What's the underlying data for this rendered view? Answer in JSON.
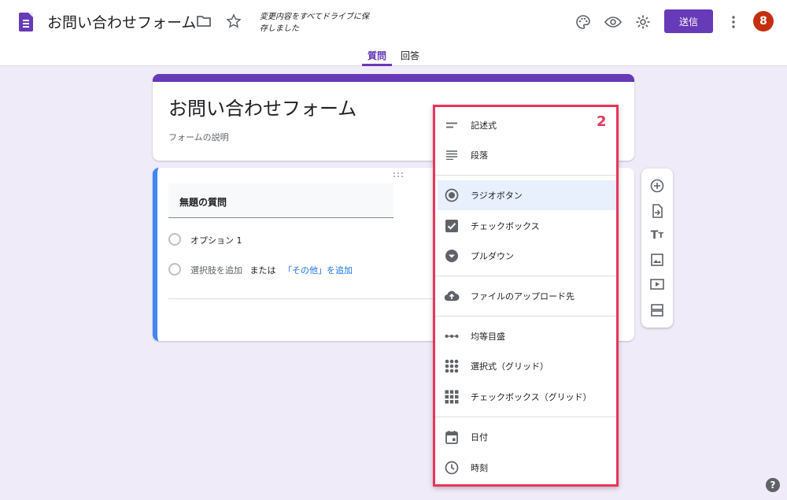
{
  "header": {
    "doc_title": "お問い合わせフォーム",
    "save_status": "変更内容をすべてドライブに保存しました",
    "send_label": "送信",
    "avatar_initial": "8",
    "accent_color": "#673ab7",
    "tabs": [
      {
        "label": "質問",
        "active": true
      },
      {
        "label": "回答",
        "active": false
      }
    ]
  },
  "form": {
    "title": "お問い合わせフォーム",
    "description_placeholder": "フォームの説明"
  },
  "question": {
    "title": "無題の質問",
    "option_1": "オプション 1",
    "add_option": "選択肢を追加",
    "or_text": "または",
    "add_other": "「その他」を追加"
  },
  "menu": {
    "marker_number": "2",
    "items": [
      {
        "label": "記述式",
        "icon": "short-answer-icon"
      },
      {
        "label": "段落",
        "icon": "paragraph-icon"
      },
      {
        "label": "ラジオボタン",
        "icon": "radio-button-icon",
        "selected": true
      },
      {
        "label": "チェックボックス",
        "icon": "checkbox-icon"
      },
      {
        "label": "プルダウン",
        "icon": "dropdown-icon"
      },
      {
        "label": "ファイルのアップロード先",
        "icon": "cloud-upload-icon"
      },
      {
        "label": "均等目盛",
        "icon": "linear-scale-icon"
      },
      {
        "label": "選択式（グリッド）",
        "icon": "grid-dots-icon"
      },
      {
        "label": "チェックボックス（グリッド）",
        "icon": "grid-squares-icon"
      },
      {
        "label": "日付",
        "icon": "calendar-icon"
      },
      {
        "label": "時刻",
        "icon": "clock-icon"
      }
    ]
  },
  "help_label": "?"
}
